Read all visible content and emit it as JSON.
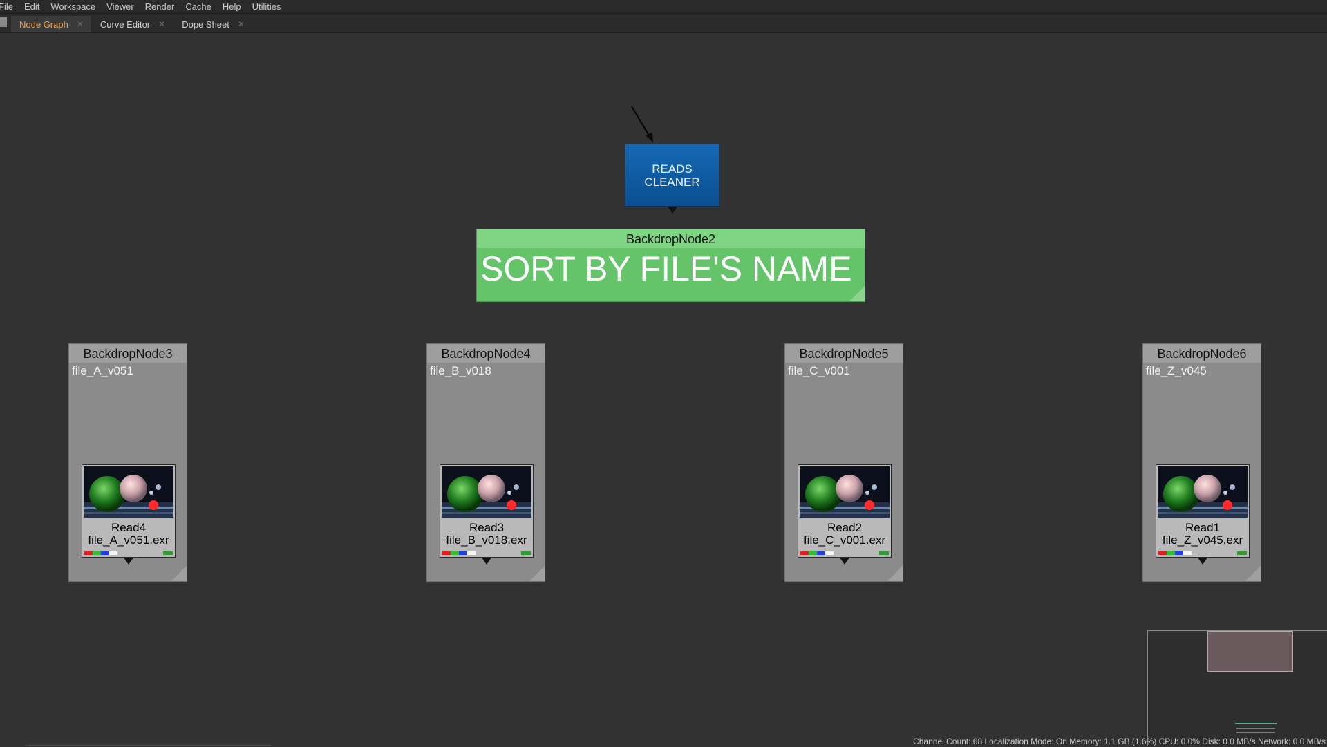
{
  "menubar": {
    "items": [
      "File",
      "Edit",
      "Workspace",
      "Viewer",
      "Render",
      "Cache",
      "Help",
      "Utilities"
    ]
  },
  "tabs": [
    {
      "label": "Node Graph",
      "active": true
    },
    {
      "label": "Curve Editor",
      "active": false
    },
    {
      "label": "Dope Sheet",
      "active": false
    }
  ],
  "graph": {
    "cleaner": {
      "line1": "READS",
      "line2": "CLEANER",
      "color": "#0b5aa3"
    },
    "main_backdrop": {
      "name": "BackdropNode2",
      "label": "SORT BY FILE'S NAME",
      "color": "#65c46a"
    },
    "backdrops": [
      {
        "name": "BackdropNode3",
        "label": "file_A_v051",
        "read_name": "Read4",
        "read_file": "file_A_v051.exr"
      },
      {
        "name": "BackdropNode4",
        "label": "file_B_v018",
        "read_name": "Read3",
        "read_file": "file_B_v018.exr"
      },
      {
        "name": "BackdropNode5",
        "label": "file_C_v001",
        "read_name": "Read2",
        "read_file": "file_C_v001.exr"
      },
      {
        "name": "BackdropNode6",
        "label": "file_Z_v045",
        "read_name": "Read1",
        "read_file": "file_Z_v045.exr"
      }
    ]
  },
  "icons": {
    "tab_close": "close-icon",
    "connector": "arrow-icon"
  },
  "status": {
    "text": "Channel Count: 68  Localization Mode: On  Memory: 1.1 GB (1.6%)  CPU: 0.0%  Disk: 0.0 MB/s  Network: 0.0 MB/s"
  }
}
